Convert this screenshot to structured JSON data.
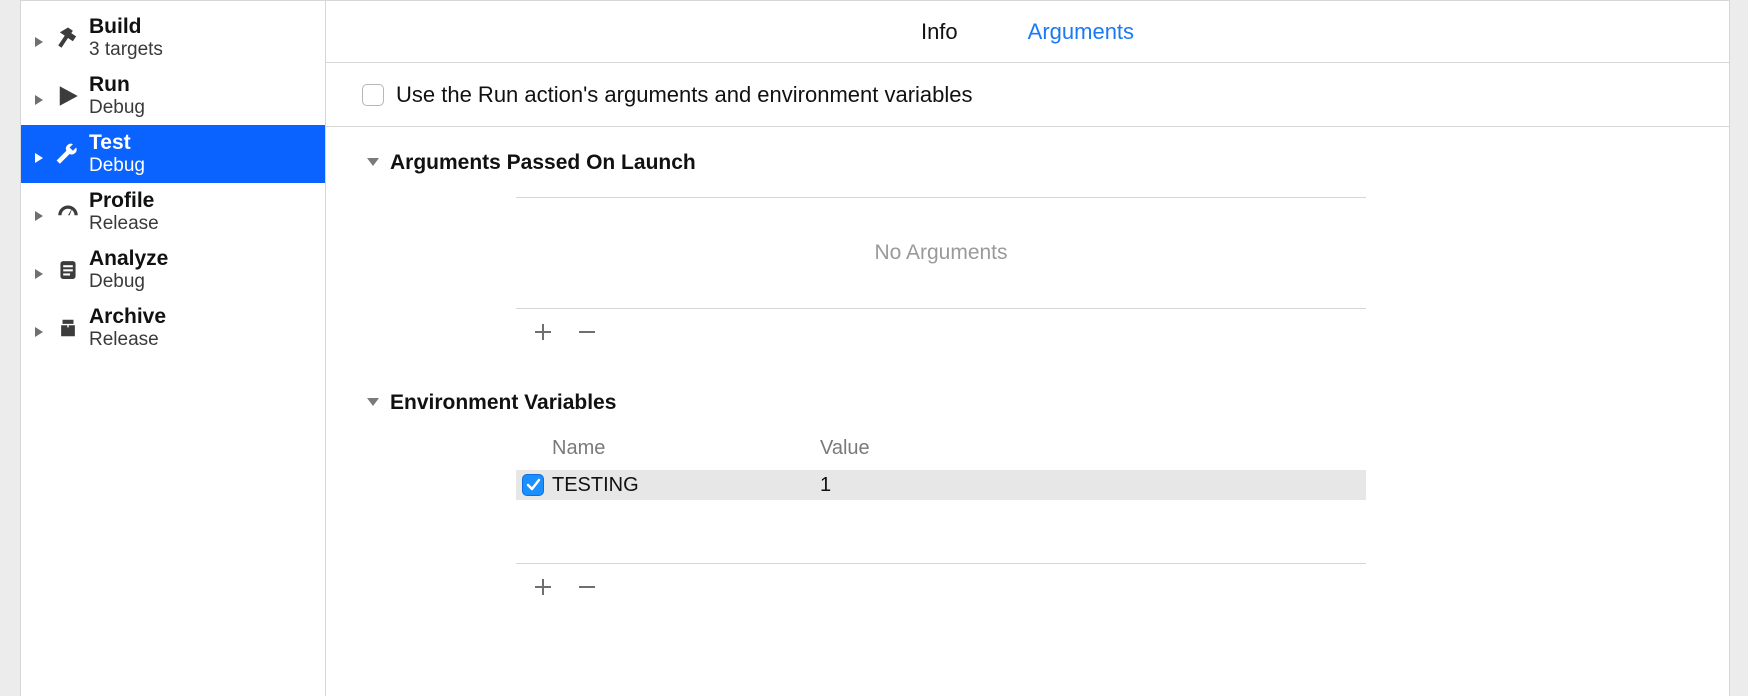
{
  "sidebar": {
    "items": [
      {
        "title": "Build",
        "subtitle": "3 targets"
      },
      {
        "title": "Run",
        "subtitle": "Debug"
      },
      {
        "title": "Test",
        "subtitle": "Debug"
      },
      {
        "title": "Profile",
        "subtitle": "Release"
      },
      {
        "title": "Analyze",
        "subtitle": "Debug"
      },
      {
        "title": "Archive",
        "subtitle": "Release"
      }
    ]
  },
  "tabs": {
    "info": "Info",
    "arguments": "Arguments"
  },
  "use_parent_label": "Use the Run action's arguments and environment variables",
  "sections": {
    "args_title": "Arguments Passed On Launch",
    "env_title": "Environment Variables",
    "args_placeholder": "No Arguments",
    "name_header": "Name",
    "value_header": "Value"
  },
  "env_rows": [
    {
      "name": "TESTING",
      "value": "1",
      "enabled": true
    }
  ]
}
